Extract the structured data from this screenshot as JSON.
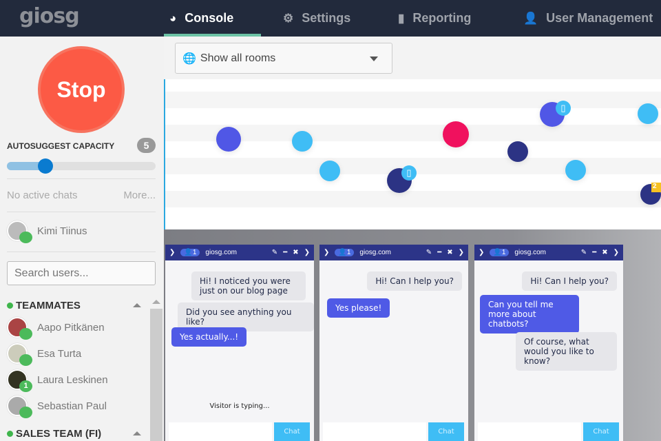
{
  "header": {
    "logo": "giosg",
    "nav": [
      {
        "label": "Console",
        "icon": "console-icon"
      },
      {
        "label": "Settings",
        "icon": "gear-icon"
      },
      {
        "label": "Reporting",
        "icon": "bar-chart-icon"
      },
      {
        "label": "User Management",
        "icon": "user-icon"
      }
    ]
  },
  "sidebar": {
    "stop_label": "Stop",
    "capacity_label": "AUTOSUGGEST CAPACITY",
    "capacity_value": "5",
    "capacity_fraction": 0.26,
    "no_active": "No active chats",
    "more": "More...",
    "current_user": "Kimi Tiinus",
    "search_placeholder": "Search users...",
    "groups": [
      {
        "name": "TEAMMATES",
        "members": [
          {
            "name": "Aapo Pitkänen",
            "badge": ""
          },
          {
            "name": "Esa Turta",
            "badge": ""
          },
          {
            "name": "Laura Leskinen",
            "badge": "1"
          },
          {
            "name": "Sebastian Paul",
            "badge": ""
          }
        ]
      },
      {
        "name": "SALES TEAM (FI)"
      }
    ]
  },
  "main": {
    "room_select": "Show all rooms",
    "visitor_badge": "2",
    "colors": {
      "violet": "#5057e6",
      "sky": "#3fbdf5",
      "pink": "#f0115e",
      "navy": "#2c3384"
    },
    "chats": [
      {
        "count": "1",
        "site": "giosg.com",
        "messages": [
          {
            "from": "op",
            "text": "Hi! I noticed you were just on our blog page"
          },
          {
            "from": "op",
            "text": "Did you see anything you like?"
          },
          {
            "from": "vi",
            "text": "Yes actually...!"
          }
        ],
        "typing": "Visitor is typing...",
        "button": "Chat"
      },
      {
        "count": "1",
        "site": "giosg.com",
        "messages": [
          {
            "from": "op",
            "text": "Hi! Can I help you?"
          },
          {
            "from": "vi",
            "text": "Yes please!"
          }
        ],
        "button": "Chat"
      },
      {
        "count": "1",
        "site": "giosg.com",
        "messages": [
          {
            "from": "op",
            "text": "Hi! Can I help you?"
          },
          {
            "from": "vi",
            "text": "Can you tell me more about chatbots?"
          },
          {
            "from": "op",
            "text": "Of course, what would you like to know?"
          }
        ],
        "button": "Chat"
      }
    ]
  }
}
